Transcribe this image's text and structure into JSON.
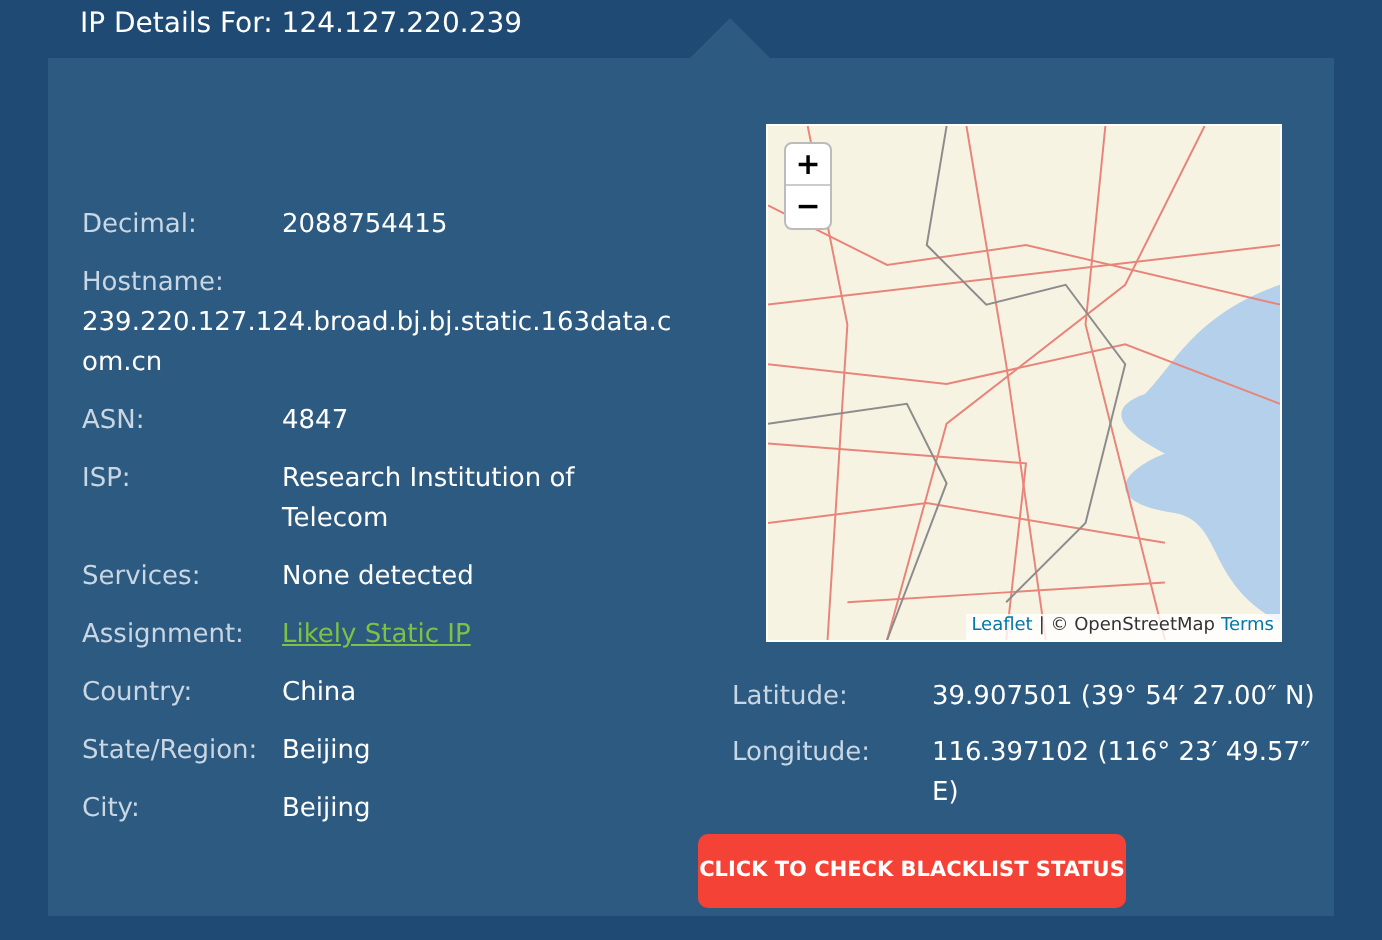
{
  "header": {
    "title": "IP Details For: 124.127.220.239"
  },
  "details": [
    {
      "label": "Decimal:",
      "value": "2088754415",
      "kind": "inline"
    },
    {
      "label": "Hostname:",
      "value": "239.220.127.124.broad.bj.bj.static.163data.com.cn",
      "kind": "block"
    },
    {
      "label": "ASN:",
      "value": "4847",
      "kind": "inline"
    },
    {
      "label": "ISP:",
      "value": "Research Institution of Telecom",
      "kind": "inline"
    },
    {
      "label": "Services:",
      "value": "None detected",
      "kind": "inline"
    },
    {
      "label": "Assignment:",
      "value": "Likely Static IP",
      "kind": "link"
    },
    {
      "label": "Country:",
      "value": "China",
      "kind": "inline"
    },
    {
      "label": "State/Region:",
      "value": "Beijing",
      "kind": "inline"
    },
    {
      "label": "City:",
      "value": "Beijing",
      "kind": "inline"
    }
  ],
  "map": {
    "zoom_in": "+",
    "zoom_out": "−",
    "attribution": {
      "leaflet": "Leaflet",
      "separator": "| © OpenStreetMap",
      "terms": "Terms"
    }
  },
  "coordinates": [
    {
      "label": "Latitude:",
      "value": "39.907501  (39° 54′ 27.00″ N)"
    },
    {
      "label": "Longitude:",
      "value": "116.397102  (116° 23′ 49.57″ E)"
    }
  ],
  "button": "CLICK TO CHECK BLACKLIST STATUS"
}
